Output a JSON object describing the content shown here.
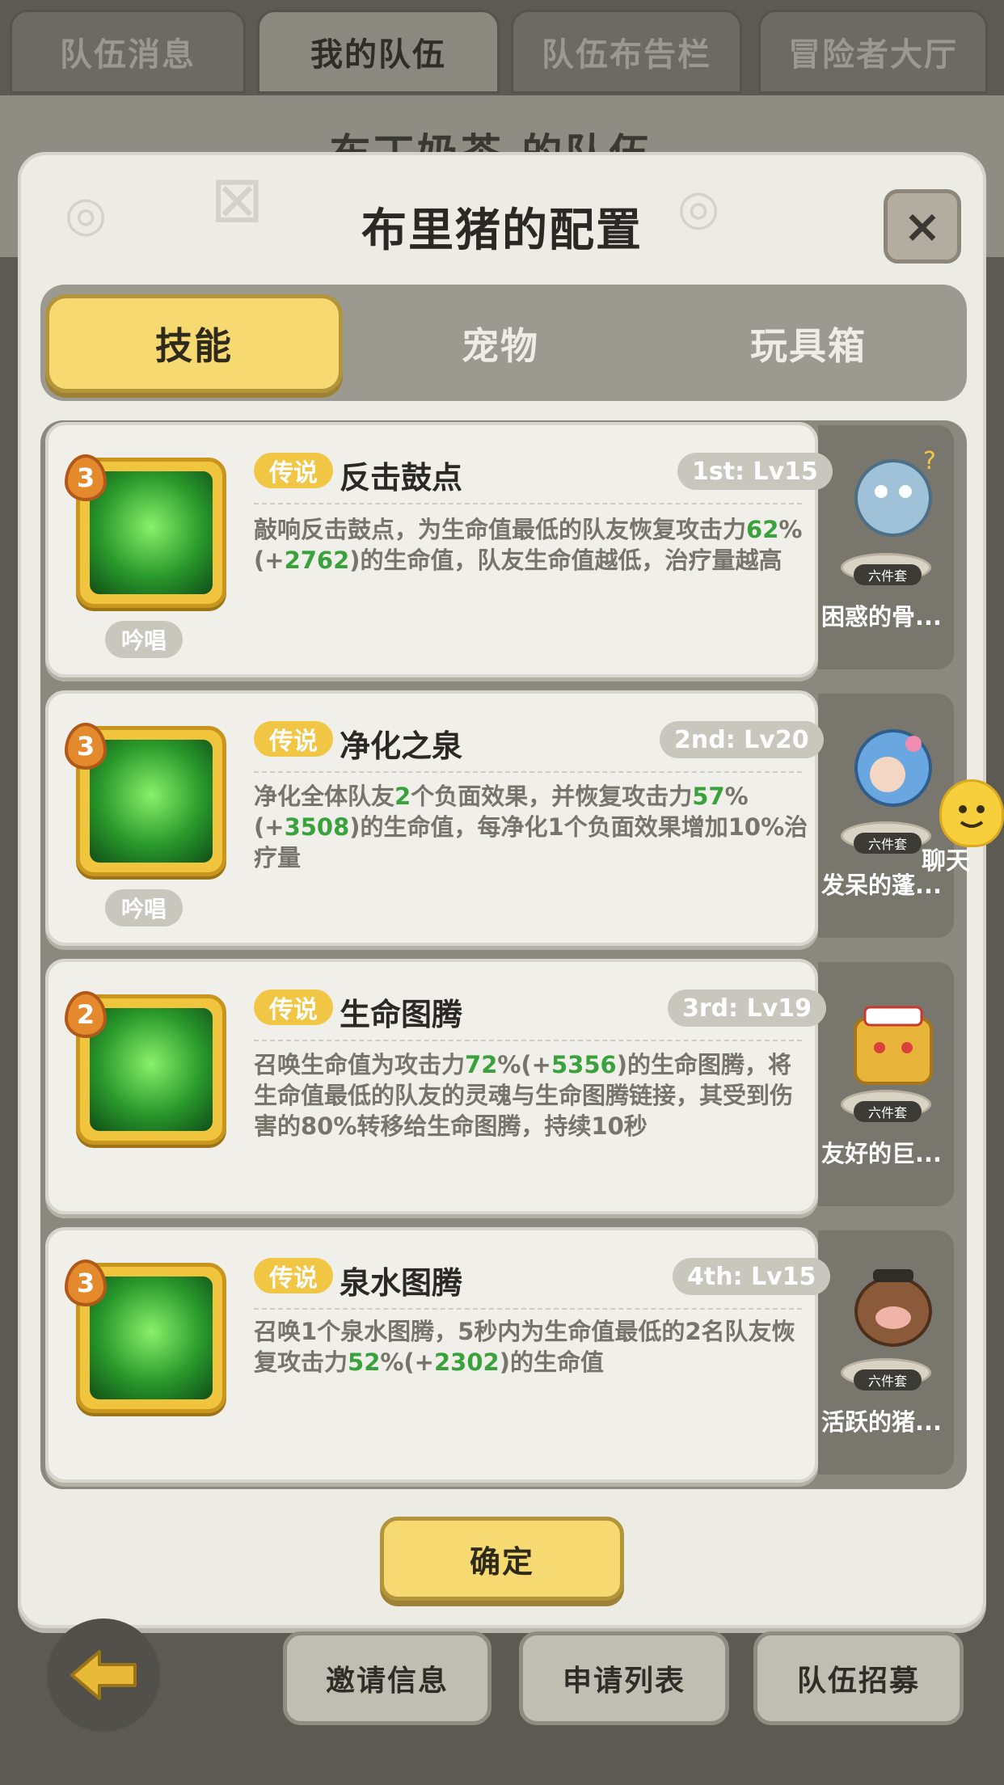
{
  "top_tabs": [
    "队伍消息",
    "我的队伍",
    "队伍布告栏",
    "冒险者大厅"
  ],
  "background_title": "布丁奶茶 的队伍",
  "modal": {
    "title": "布里猪的配置",
    "close_label": "×",
    "tabs": [
      "技能",
      "宠物",
      "玩具箱"
    ],
    "confirm_label": "确定"
  },
  "skills": [
    {
      "badge": "3",
      "tag": "传说",
      "name": "反击鼓点",
      "level": "1st: Lv15",
      "chant": "吟唱",
      "desc": [
        {
          "t": "敲响反击鼓点，为生命值最低的队友恢复攻击力",
          "g": false
        },
        {
          "t": "62",
          "g": true
        },
        {
          "t": "%(+",
          "g": false
        },
        {
          "t": "2762",
          "g": true
        },
        {
          "t": ")的生命值，队友生命值越低，治疗量越高",
          "g": false
        }
      ]
    },
    {
      "badge": "3",
      "tag": "传说",
      "name": "净化之泉",
      "level": "2nd: Lv20",
      "chant": "吟唱",
      "desc": [
        {
          "t": "净化全体队友",
          "g": false
        },
        {
          "t": "2",
          "g": true
        },
        {
          "t": "个负面效果，并恢复攻击力",
          "g": false
        },
        {
          "t": "57",
          "g": true
        },
        {
          "t": "%(+",
          "g": false
        },
        {
          "t": "3508",
          "g": true
        },
        {
          "t": ")的生命值，每净化1个负面效果增加10%治疗量",
          "g": false
        }
      ]
    },
    {
      "badge": "2",
      "tag": "传说",
      "name": "生命图腾",
      "level": "3rd: Lv19",
      "chant": "",
      "desc": [
        {
          "t": "召唤生命值为攻击力",
          "g": false
        },
        {
          "t": "72",
          "g": true
        },
        {
          "t": "%(+",
          "g": false
        },
        {
          "t": "5356",
          "g": true
        },
        {
          "t": ")的生命图腾，将生命值最低的队友的灵魂与生命图腾链接，其受到伤害的80%转移给生命图腾，持续10秒",
          "g": false
        }
      ]
    },
    {
      "badge": "3",
      "tag": "传说",
      "name": "泉水图腾",
      "level": "4th: Lv15",
      "chant": "",
      "desc": [
        {
          "t": "召唤1个泉水图腾，5秒内为生命值最低的2名队友恢复攻击力",
          "g": false
        },
        {
          "t": "52",
          "g": true
        },
        {
          "t": "%(+",
          "g": false
        },
        {
          "t": "2302",
          "g": true
        },
        {
          "t": ")的生命值",
          "g": false
        }
      ]
    }
  ],
  "pets": [
    {
      "name": "困惑的骨...",
      "set_label": "六件套",
      "color": "#9fc2d8"
    },
    {
      "name": "发呆的蓬...",
      "set_label": "六件套",
      "color": "#6aa6e0"
    },
    {
      "name": "友好的巨...",
      "set_label": "六件套",
      "color": "#e8b53a"
    },
    {
      "name": "活跃的猪...",
      "set_label": "六件套",
      "color": "#8a5a3a"
    }
  ],
  "chat_label": "聊天",
  "bottom_buttons": [
    "邀请信息",
    "申请列表",
    "队伍招募"
  ],
  "colors": {
    "accent_yellow": "#f6d971",
    "highlight_green": "#3aa23c",
    "badge_orange": "#e58a2c"
  }
}
